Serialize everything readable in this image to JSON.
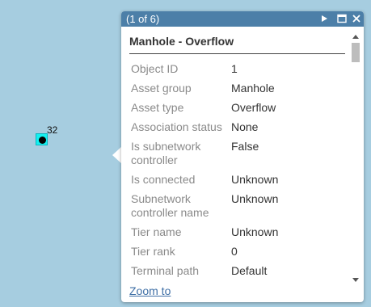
{
  "map": {
    "feature_label": "32"
  },
  "popup": {
    "count": "(1 of 6)",
    "title": "Manhole - Overflow",
    "fields": [
      {
        "name": "Object ID",
        "value": "1"
      },
      {
        "name": "Asset group",
        "value": "Manhole"
      },
      {
        "name": "Asset type",
        "value": "Overflow"
      },
      {
        "name": "Association status",
        "value": "None"
      },
      {
        "name": "Is subnetwork controller",
        "value": "False"
      },
      {
        "name": "Is connected",
        "value": "Unknown"
      },
      {
        "name": "Subnetwork controller name",
        "value": "Unknown"
      },
      {
        "name": "Tier name",
        "value": "Unknown"
      },
      {
        "name": "Tier rank",
        "value": "0"
      },
      {
        "name": "Terminal path",
        "value": "Default"
      }
    ],
    "zoom_label": "Zoom to",
    "header_icons": [
      "next-icon",
      "maximize-icon",
      "close-icon"
    ]
  },
  "colors": {
    "map_background": "#a6cde0",
    "header": "#4c7fa8",
    "highlight": "#14f0ef",
    "link": "#3f6fa6"
  }
}
